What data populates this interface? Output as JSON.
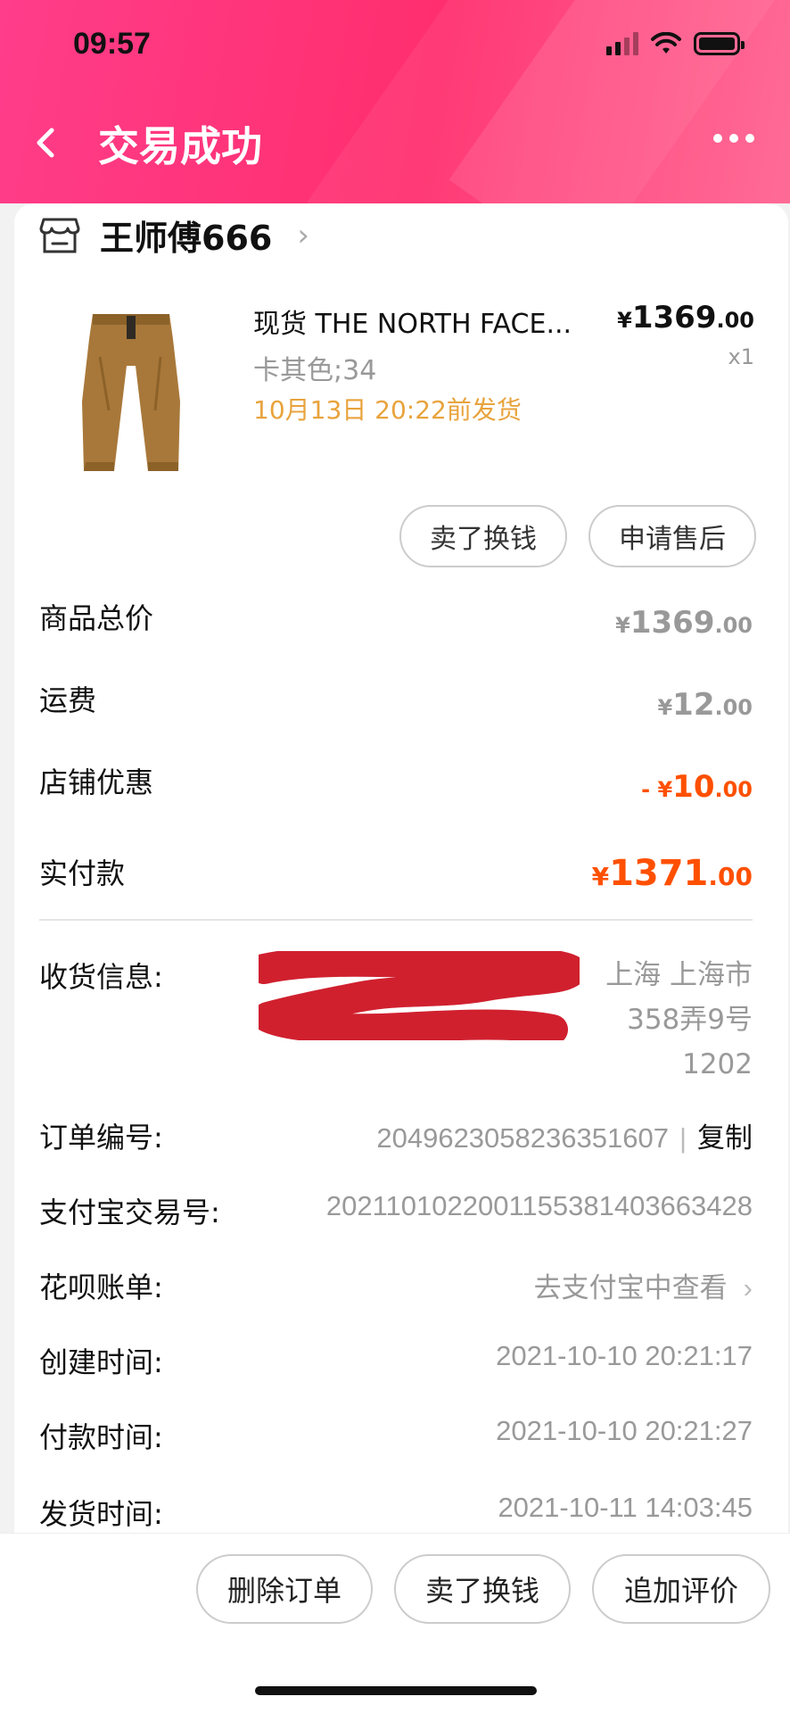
{
  "status_bar": {
    "time": "09:57"
  },
  "header": {
    "title": "交易成功"
  },
  "shop": {
    "name": "王师傅666"
  },
  "product": {
    "title": "现货 THE NORTH FACE...",
    "spec": "卡其色;34",
    "ship_deadline": "10月13日 20:22前发货",
    "price_currency": "¥",
    "price_int": "1369",
    "price_dec": ".00",
    "quantity": "x1"
  },
  "actions": {
    "sell": "卖了换钱",
    "after_sale": "申请售后"
  },
  "summary": {
    "items_label": "商品总价",
    "items_cur": "¥",
    "items_int": "1369",
    "items_dec": ".00",
    "shipping_label": "运费",
    "shipping_cur": "¥",
    "shipping_int": "12",
    "shipping_dec": ".00",
    "discount_label": "店铺优惠",
    "discount_cur": "- ¥",
    "discount_int": "10",
    "discount_dec": ".00",
    "paid_label": "实付款",
    "paid_cur": "¥",
    "paid_int": "1371",
    "paid_dec": ".00"
  },
  "info": {
    "address_label": "收货信息:",
    "address_line1": "上海 上海市",
    "address_line2": "358弄9号",
    "address_line3": "1202",
    "order_label": "订单编号:",
    "order_value": "2049623058236351607",
    "copy_label": "复制",
    "alipay_label": "支付宝交易号:",
    "alipay_value": "2021101022001155381403663428",
    "huabei_label": "花呗账单:",
    "huabei_value": "去支付宝中查看",
    "created_label": "创建时间:",
    "created_value": "2021-10-10 20:21:17",
    "paid_time_label": "付款时间:",
    "paid_time_value": "2021-10-10 20:21:27",
    "shipped_label": "发货时间:",
    "shipped_value": "2021-10-11 14:03:45"
  },
  "bottom": {
    "delete": "删除订单",
    "sell": "卖了换钱",
    "review": "追加评价"
  },
  "colors": {
    "header": "#ff2e6e",
    "orange": "#ff5000",
    "ship": "#e8a33c"
  }
}
